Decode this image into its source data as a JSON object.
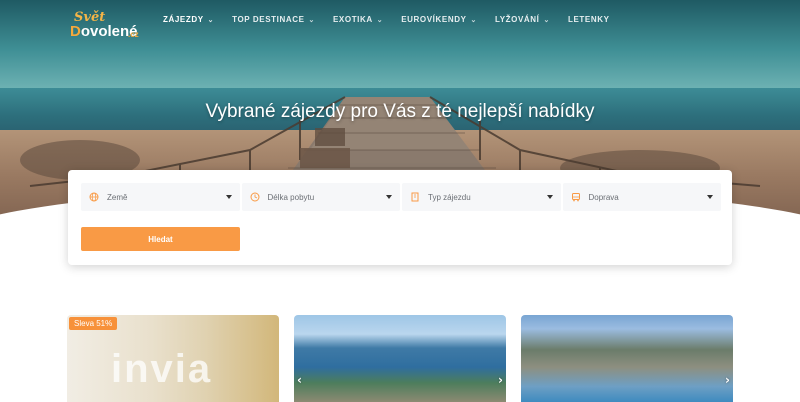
{
  "logo": {
    "line1": "Svět",
    "line2_colored": "D",
    "line2_rest": "ovolené",
    "suffix": ".cz"
  },
  "nav": {
    "items": [
      {
        "label": "ZÁJEZDY",
        "dropdown": true,
        "active": true
      },
      {
        "label": "TOP DESTINACE",
        "dropdown": true
      },
      {
        "label": "EXOTIKA",
        "dropdown": true
      },
      {
        "label": "EUROVÍKENDY",
        "dropdown": true
      },
      {
        "label": "LYŽOVÁNÍ",
        "dropdown": true
      },
      {
        "label": "LETENKY",
        "dropdown": false
      }
    ]
  },
  "hero": {
    "headline": "Vybrané zájezdy pro Vás z té nejlepší nabídky"
  },
  "search": {
    "fields": [
      {
        "label": "Země",
        "icon": "globe-icon"
      },
      {
        "label": "Délka pobytu",
        "icon": "clock-icon"
      },
      {
        "label": "Typ zájezdu",
        "icon": "building-icon"
      },
      {
        "label": "Doprava",
        "icon": "bus-icon"
      }
    ],
    "button_label": "Hledat"
  },
  "offers": [
    {
      "badge": "Sleva 51%",
      "watermark": "invia"
    },
    {
      "badge": null
    },
    {
      "badge": null
    }
  ],
  "colors": {
    "accent": "#f99a45",
    "badge": "#f7913a",
    "nav_text": "#ffffff"
  }
}
